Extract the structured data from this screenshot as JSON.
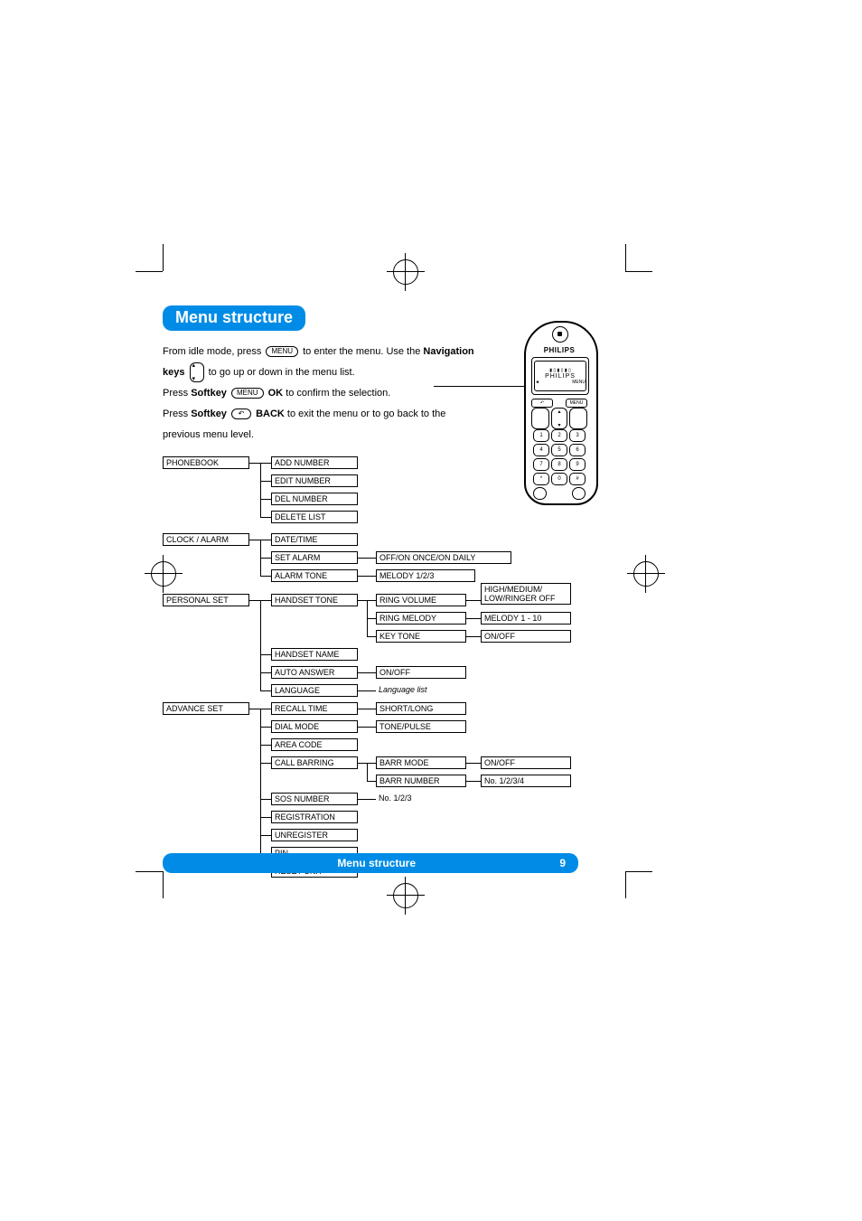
{
  "header": {
    "title": "Menu structure"
  },
  "intro": {
    "l1a": "From idle mode, press ",
    "l1_key": "MENU",
    "l1b": " to enter the menu. Use the ",
    "l1_bold": "Navigation",
    "l2_bold": "keys",
    "l2b": " to go up or down in the menu list.",
    "l3a": "Press ",
    "l3_bold1": "Softkey",
    "l3_key": "MENU",
    "l3_bold2": "OK",
    "l3b": " to confirm the selection.",
    "l4a": "Press ",
    "l4_bold1": "Softkey",
    "l4_key": "↶",
    "l4_bold2": "BACK",
    "l4b": " to exit the menu or to go back to the",
    "l5": "previous menu level."
  },
  "phone": {
    "brand": "PHILIPS",
    "screen_text": "PHILIPS",
    "screen_softleft": "◄",
    "screen_softright": "MENU",
    "keys": {
      "r1": [
        "1",
        "2",
        "3"
      ],
      "r2": [
        "4",
        "5",
        "6"
      ],
      "r3": [
        "7",
        "8",
        "9"
      ],
      "r4": [
        "*",
        "0",
        "#"
      ]
    }
  },
  "menu": {
    "phonebook": {
      "label": "PHONEBOOK",
      "items": [
        "ADD NUMBER",
        "EDIT NUMBER",
        "DEL NUMBER",
        "DELETE LIST"
      ]
    },
    "clock": {
      "label": "CLOCK / ALARM",
      "items": [
        "DATE/TIME",
        "SET ALARM",
        "ALARM TONE"
      ],
      "set_alarm_opt": "OFF/ON ONCE/ON DAILY",
      "alarm_tone_opt": "MELODY 1/2/3"
    },
    "personal": {
      "label": "PERSONAL SET",
      "handset_tone": {
        "label": "HANDSET TONE",
        "items": [
          "RING VOLUME",
          "RING MELODY",
          "KEY TONE"
        ],
        "ring_volume_opt": "HIGH/MEDIUM/\nLOW/RINGER OFF",
        "ring_melody_opt": "MELODY 1 - 10",
        "key_tone_opt": "ON/OFF"
      },
      "handset_name": "HANDSET NAME",
      "auto_answer": {
        "label": "AUTO ANSWER",
        "opt": "ON/OFF"
      },
      "language": {
        "label": "LANGUAGE",
        "opt": "Language list"
      }
    },
    "advance": {
      "label": "ADVANCE SET",
      "recall_time": {
        "label": "RECALL TIME",
        "opt": "SHORT/LONG"
      },
      "dial_mode": {
        "label": "DIAL MODE",
        "opt": "TONE/PULSE"
      },
      "area_code": "AREA CODE",
      "call_barring": {
        "label": "CALL BARRING",
        "barr_mode": {
          "label": "BARR MODE",
          "opt": "ON/OFF"
        },
        "barr_number": {
          "label": "BARR NUMBER",
          "opt": "No. 1/2/3/4"
        }
      },
      "sos_number": {
        "label": "SOS NUMBER",
        "opt": "No. 1/2/3"
      },
      "registration": "REGISTRATION",
      "unregister": "UNREGISTER",
      "pin": "PIN",
      "reset_unit": "RESET UNIT"
    }
  },
  "footer": {
    "title": "Menu structure",
    "page": "9"
  }
}
